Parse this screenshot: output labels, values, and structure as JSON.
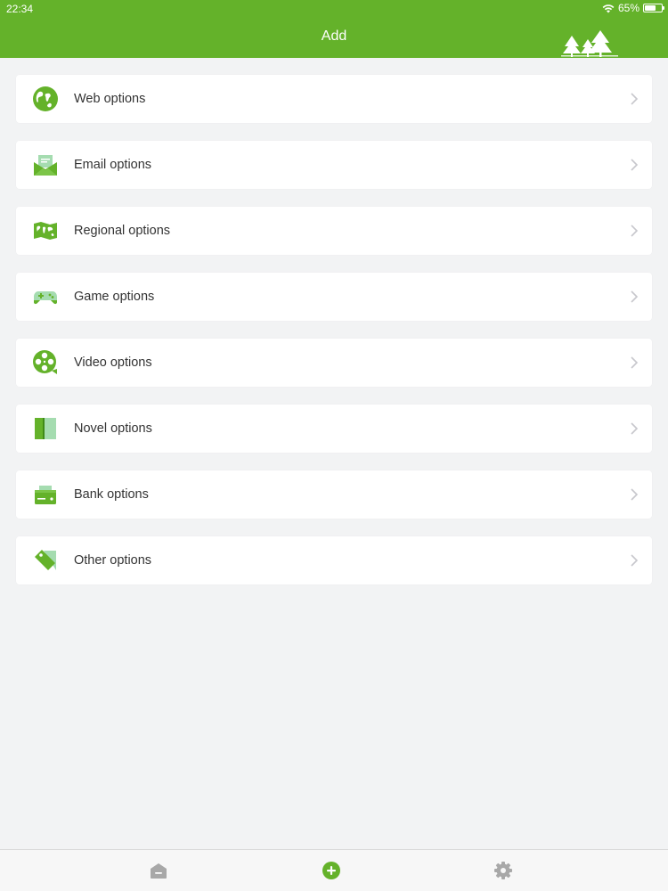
{
  "status_bar": {
    "time": "22:34",
    "battery_percent": "65%",
    "battery_level": 0.65
  },
  "nav": {
    "title": "Add"
  },
  "colors": {
    "brand_green": "#64b22a",
    "icon_green": "#64b22a",
    "icon_light_green": "#a5dcb0",
    "background": "#f2f3f4",
    "text": "#333333",
    "chevron": "#c7c7cc",
    "tab_inactive": "#a8a8a8"
  },
  "menu": {
    "items": [
      {
        "label": "Web options",
        "icon": "globe-icon"
      },
      {
        "label": "Email options",
        "icon": "envelope-icon"
      },
      {
        "label": "Regional options",
        "icon": "world-map-icon"
      },
      {
        "label": "Game options",
        "icon": "gamepad-icon"
      },
      {
        "label": "Video options",
        "icon": "film-reel-icon"
      },
      {
        "label": "Novel options",
        "icon": "book-icon"
      },
      {
        "label": "Bank options",
        "icon": "wallet-icon"
      },
      {
        "label": "Other options",
        "icon": "tag-icon"
      }
    ]
  },
  "tabbar": {
    "tabs": [
      {
        "icon": "home-icon",
        "active": false
      },
      {
        "icon": "add-circle-icon",
        "active": true
      },
      {
        "icon": "gear-icon",
        "active": false
      }
    ]
  }
}
